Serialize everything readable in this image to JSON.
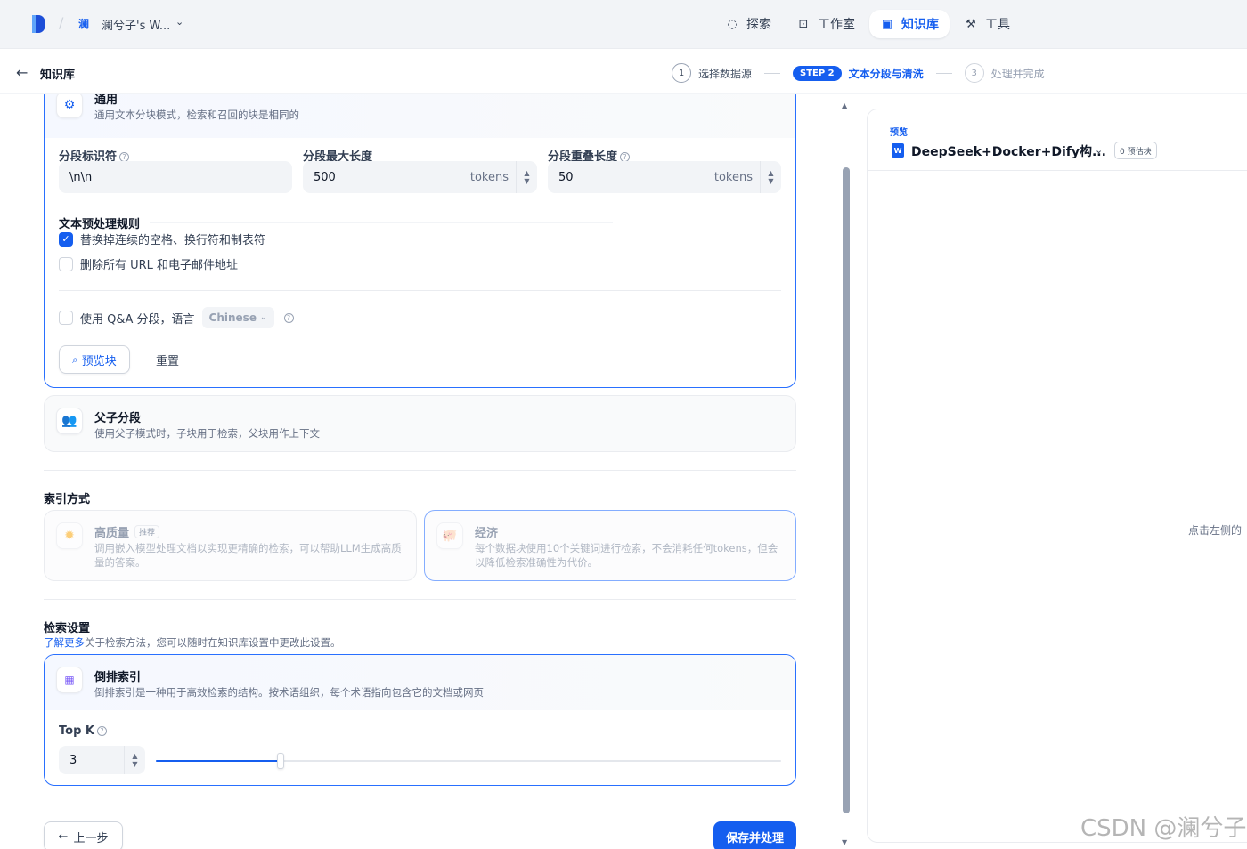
{
  "workspace": {
    "avatar": "澜",
    "name": "澜兮子's W..."
  },
  "nav": [
    {
      "label": "探索",
      "icon": "compass-icon"
    },
    {
      "label": "工作室",
      "icon": "robot-icon"
    },
    {
      "label": "知识库",
      "icon": "book-icon",
      "active": true
    },
    {
      "label": "工具",
      "icon": "hammer-icon"
    }
  ],
  "subheader": {
    "back_label": "知识库",
    "steps": [
      {
        "num": "1",
        "label": "选择数据源"
      },
      {
        "num": "STEP 2",
        "label": "文本分段与清洗"
      },
      {
        "num": "3",
        "label": "处理并完成"
      }
    ]
  },
  "segment": {
    "general": {
      "title": "通用",
      "desc": "通用文本分块模式，检索和召回的块是相同的"
    },
    "delimiter": {
      "label": "分段标识符",
      "value": "\\n\\n"
    },
    "max_length": {
      "label": "分段最大长度",
      "value": "500",
      "unit": "tokens"
    },
    "overlap": {
      "label": "分段重叠长度",
      "value": "50",
      "unit": "tokens"
    },
    "rules_label": "文本预处理规则",
    "rule1": {
      "label": "替换掉连续的空格、换行符和制表符",
      "checked": true
    },
    "rule2": {
      "label": "删除所有 URL 和电子邮件地址",
      "checked": false
    },
    "qa": {
      "label": "使用 Q&A 分段，语言",
      "language": "Chinese",
      "checked": false
    },
    "preview_btn": "预览块",
    "reset_btn": "重置",
    "parent_child": {
      "title": "父子分段",
      "desc": "使用父子模式时，子块用于检索，父块用作上下文"
    }
  },
  "index": {
    "label": "索引方式",
    "high_quality": {
      "title": "高质量",
      "tag": "推荐",
      "desc": "调用嵌入模型处理文档以实现更精确的检索，可以帮助LLM生成高质量的答案。"
    },
    "economy": {
      "title": "经济",
      "desc": "每个数据块使用10个关键词进行检索，不会消耗任何tokens，但会以降低检索准确性为代价。"
    }
  },
  "retrieval": {
    "label": "检索设置",
    "learn_more": "了解更多",
    "hint": "关于检索方法，您可以随时在知识库设置中更改此设置。",
    "inverted": {
      "title": "倒排索引",
      "desc": "倒排索引是一种用于高效检索的结构。按术语组织，每个术语指向包含它的文档或网页"
    },
    "topk_label": "Top K",
    "topk_value": "3",
    "topk_fraction": 0.2
  },
  "footer": {
    "prev_btn": "上一步",
    "save_btn": "保存并处理"
  },
  "preview": {
    "label": "预览",
    "doc_title": "DeepSeek+Docker+Dify构...",
    "badge": "0 预估块",
    "hint": "点击左侧的"
  },
  "watermark": "CSDN @澜兮子",
  "colors": {
    "accent": "#155eef",
    "border_active": "#2970ff"
  }
}
